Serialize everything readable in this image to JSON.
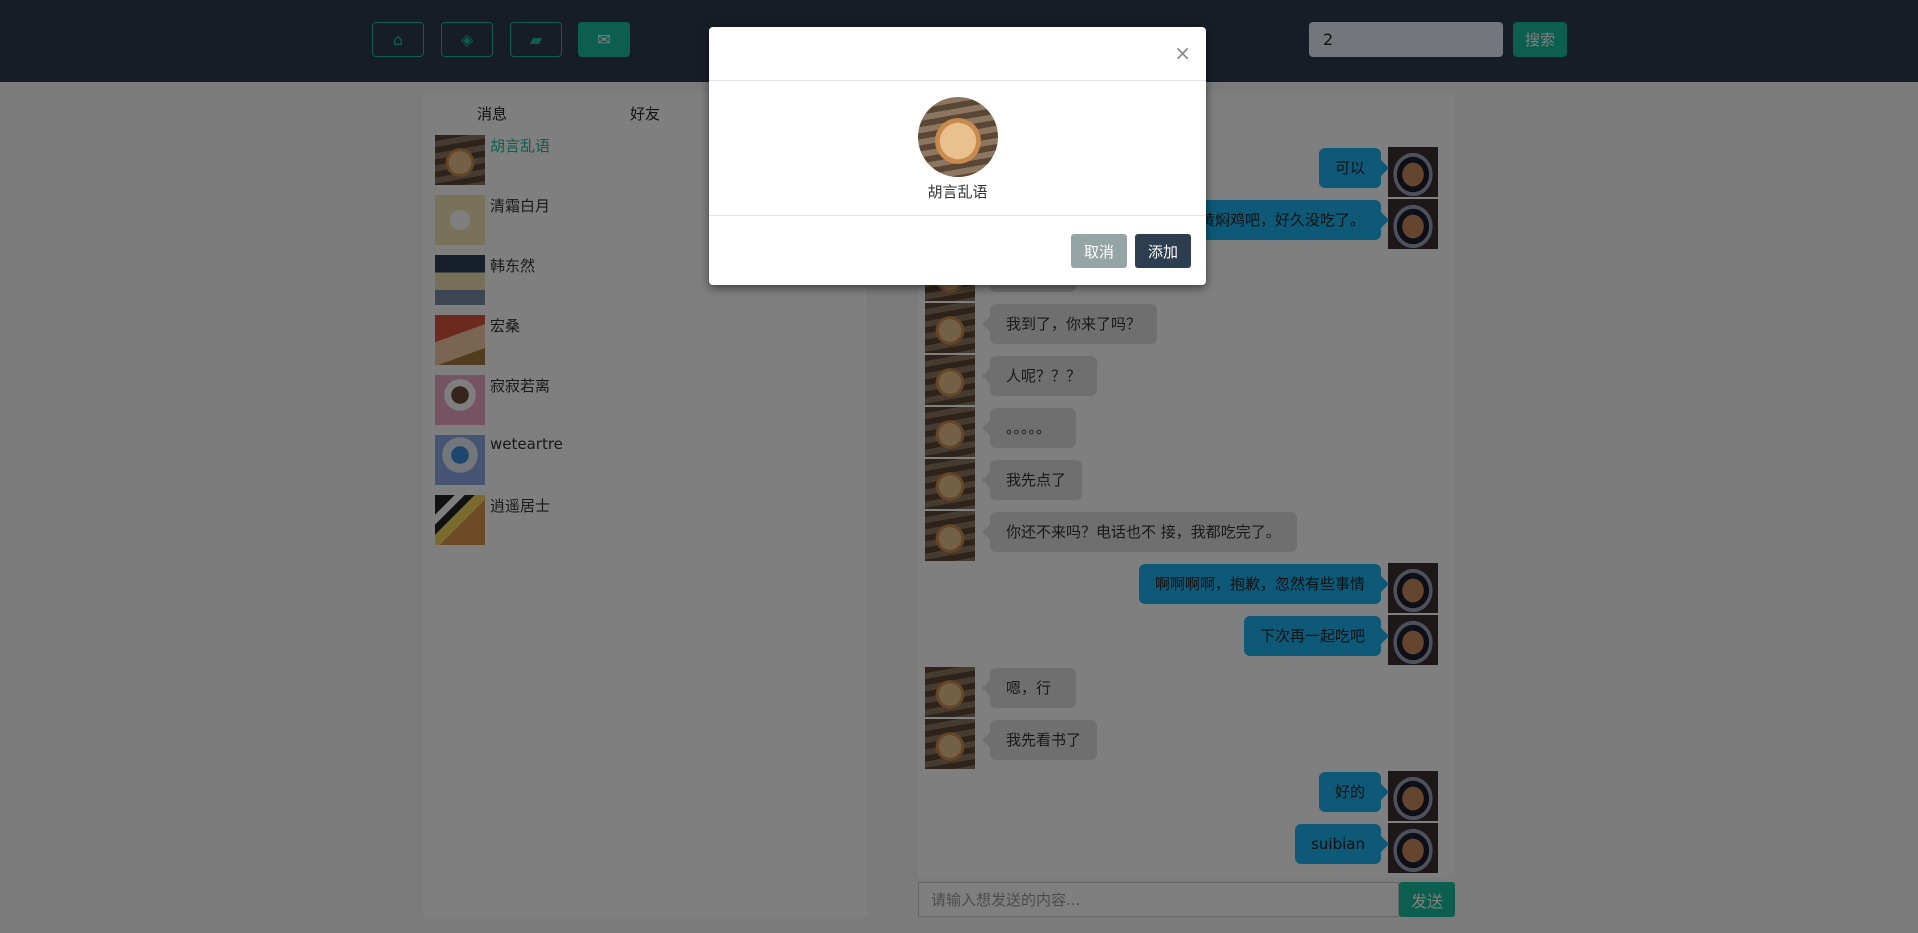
{
  "header": {
    "nav": [
      {
        "icon": "home-icon",
        "glyph": "⌂"
      },
      {
        "icon": "tags-icon",
        "glyph": "◈"
      },
      {
        "icon": "comment-icon",
        "glyph": "▰"
      },
      {
        "icon": "envelope-icon",
        "glyph": "✉"
      }
    ],
    "search_value": "2",
    "search_label": "搜索"
  },
  "sidebar": {
    "tabs": [
      "消息",
      "好友"
    ],
    "items": [
      {
        "name": "胡言乱语",
        "selected": true
      },
      {
        "name": "清霜白月"
      },
      {
        "name": "韩东然"
      },
      {
        "name": "宏桑"
      },
      {
        "name": "寂寂若离"
      },
      {
        "name": "weteartre"
      },
      {
        "name": "逍遥居士"
      }
    ]
  },
  "chat": {
    "messages": [
      {
        "side": "r",
        "text": "可以"
      },
      {
        "side": "r",
        "text": "黄焖鸡吧，好久没吃了。"
      },
      {
        "side": "l",
        "text": ""
      },
      {
        "side": "l",
        "text": "我到了，你来了吗？"
      },
      {
        "side": "l",
        "text": "人呢？？？"
      },
      {
        "side": "l",
        "text": "。。。。。"
      },
      {
        "side": "l",
        "text": "我先点了"
      },
      {
        "side": "l",
        "text": "你还不来吗？电话也不 接，我都吃完了。"
      },
      {
        "side": "r",
        "text": "啊啊啊啊，抱歉，忽然有些事情"
      },
      {
        "side": "r",
        "text": "下次再一起吃吧"
      },
      {
        "side": "l",
        "text": "嗯，行"
      },
      {
        "side": "l",
        "text": "我先看书了"
      },
      {
        "side": "r",
        "text": "好的"
      },
      {
        "side": "r",
        "text": "suibian"
      }
    ],
    "input_placeholder": "请输入想发送的内容...",
    "send_label": "发送"
  },
  "modal": {
    "close": "×",
    "name": "胡言乱语",
    "cancel_label": "取消",
    "add_label": "添加"
  },
  "colors": {
    "primary": "#2c3e50",
    "success": "#18bc9c",
    "info": "#1ab3ee",
    "muted": "#95a5a6"
  }
}
